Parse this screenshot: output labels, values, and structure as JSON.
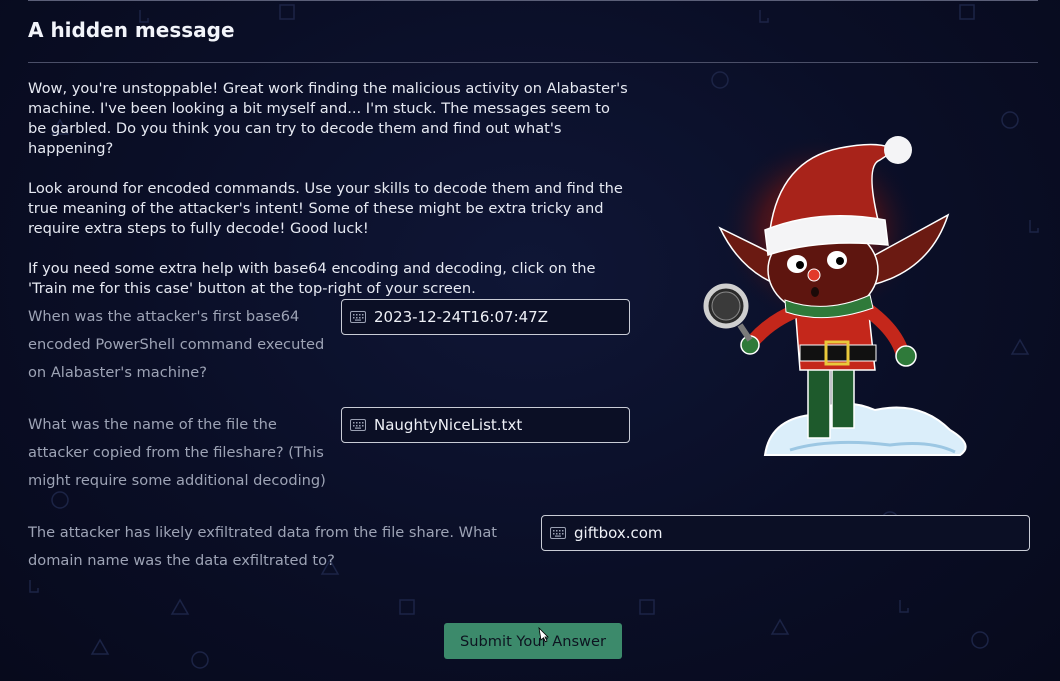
{
  "page": {
    "title": "A hidden message",
    "paragraphs": [
      "Wow, you're unstoppable! Great work finding the malicious activity on Alabaster's machine. I've been looking a bit myself and... I'm stuck. The messages seem to be garbled. Do you think you can try to decode them and find out what's happening?",
      "Look around for encoded commands. Use your skills to decode them and find the true meaning of the attacker's intent! Some of these might be extra tricky and require extra steps to fully decode! Good luck!",
      "If you need some extra help with base64 encoding and decoding, click on the 'Train me for this case' button at the top-right of your screen."
    ]
  },
  "questions": [
    {
      "label": "When was the attacker's first base64 encoded PowerShell command executed on Alabaster's machine?",
      "value": "2023-12-24T16:07:47Z",
      "icon": "keyboard-icon"
    },
    {
      "label": "What was the name of the file the attacker copied from the fileshare? (This might require some additional decoding)",
      "value": "NaughtyNiceList.txt",
      "icon": "keyboard-icon"
    },
    {
      "label": "The attacker has likely exfiltrated data from the file share. What domain name was the data exfiltrated to?",
      "value": "giftbox.com",
      "icon": "keyboard-icon"
    }
  ],
  "submit": {
    "label": "Submit Your Answer"
  },
  "colors": {
    "background": "#0a0e26",
    "submit_button": "#3c8a6b",
    "field_border": "#c9ccd6"
  },
  "illustration": {
    "icon": "elf-with-magnifying-glass"
  }
}
